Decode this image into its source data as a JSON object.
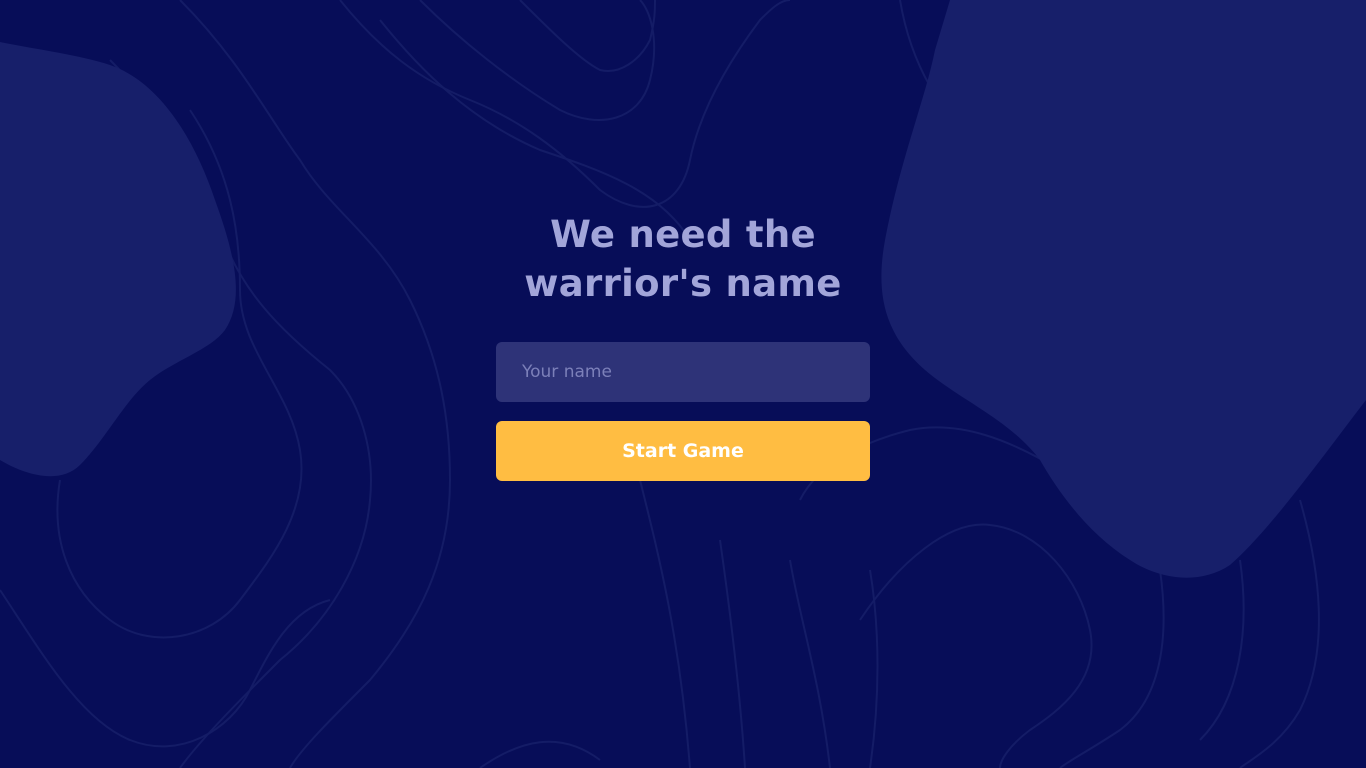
{
  "heading": {
    "line1": "We need the",
    "line2": "warrior's name"
  },
  "name_input": {
    "value": "",
    "placeholder": "Your name"
  },
  "start_button": {
    "label": "Start Game"
  },
  "colors": {
    "background": "#070d58",
    "blob": "#171f6a",
    "contour": "#141c66",
    "heading": "#a2a5d9",
    "input_bg": "#2e3378",
    "button_bg": "#ffbd42",
    "button_text": "#ffffff"
  }
}
